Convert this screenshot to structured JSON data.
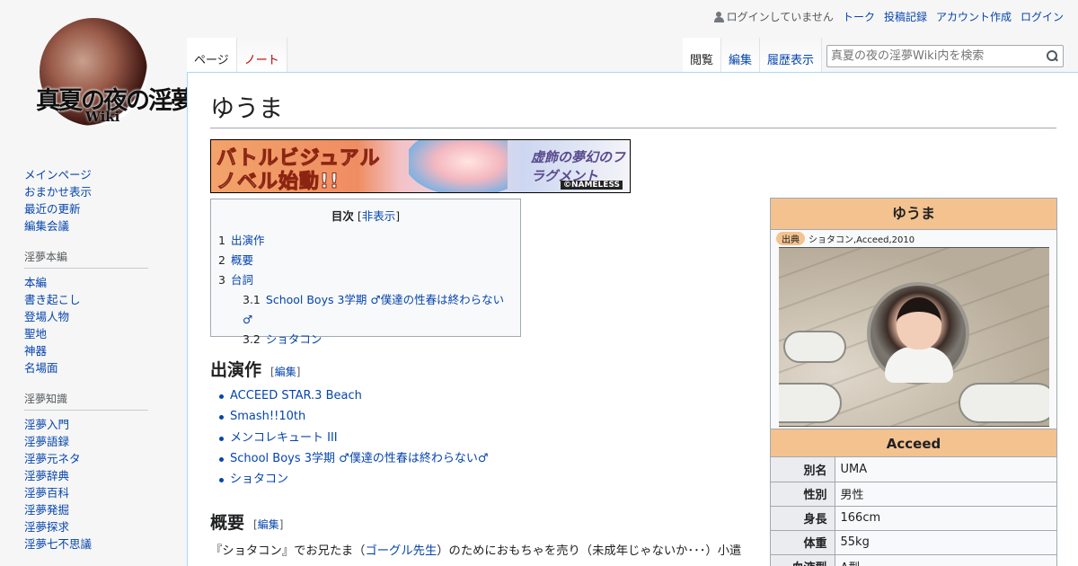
{
  "personal": {
    "status": "ログインしていません",
    "talk": "トーク",
    "contributions": "投稿記録",
    "create_account": "アカウント作成",
    "login": "ログイン"
  },
  "logo": {
    "title": "真夏の夜の淫夢",
    "subtitle": "Wiki"
  },
  "sidebar": {
    "main": [
      "メインページ",
      "おまかせ表示",
      "最近の更新",
      "編集会議"
    ],
    "section1": {
      "heading": "淫夢本編",
      "items": [
        "本編",
        "書き起こし",
        "登場人物",
        "聖地",
        "神器",
        "名場面"
      ]
    },
    "section2": {
      "heading": "淫夢知識",
      "items": [
        "淫夢入門",
        "淫夢語録",
        "淫夢元ネタ",
        "淫夢辞典",
        "淫夢百科",
        "淫夢発掘",
        "淫夢探求",
        "淫夢七不思議"
      ]
    }
  },
  "tabs": {
    "page": "ページ",
    "note": "ノート",
    "read": "閲覧",
    "edit": "編集",
    "history": "履歴表示"
  },
  "search": {
    "placeholder": "真夏の夜の淫夢Wiki内を検索"
  },
  "page": {
    "title": "ゆうま"
  },
  "banner": {
    "line1": "バトルビジュアル",
    "line2": "ノベル始動!!",
    "brand": "虚飾の夢幻のフラグメント",
    "copyright": "©NAMELESS"
  },
  "toc": {
    "title": "目次",
    "toggle_open": "[",
    "toggle": "非表示",
    "toggle_close": "]",
    "items": [
      {
        "num": "1",
        "label": "出演作"
      },
      {
        "num": "2",
        "label": "概要"
      },
      {
        "num": "3",
        "label": "台詞"
      },
      {
        "num": "3.1",
        "label": "School Boys 3学期 ♂僕達の性春は終わらない♂"
      },
      {
        "num": "3.2",
        "label": "ショタコン"
      }
    ]
  },
  "sections": {
    "works_heading": "出演作",
    "overview_heading": "概要",
    "edit_label": "編集",
    "edit_open": "[",
    "edit_close": "]"
  },
  "works": [
    "ACCEED STAR.3 Beach",
    "Smash!!10th",
    "メンコレキュート III",
    "School Boys 3学期 ♂僕達の性春は終わらない♂",
    "ショタコン"
  ],
  "overview": {
    "before": "『ショタコン』でお兄たま（",
    "link": "ゴーグル先生",
    "after": "）のためにおもちゃを売り（未成年じゃないか･･･）小遣"
  },
  "infobox": {
    "title": "ゆうま",
    "source_tag": "出典",
    "source": "ショタコン,Acceed,2010",
    "section": "Acceed",
    "rows": [
      {
        "key": "別名",
        "value": "UMA"
      },
      {
        "key": "性別",
        "value": "男性"
      },
      {
        "key": "身長",
        "value": "166cm"
      },
      {
        "key": "体重",
        "value": "55kg"
      },
      {
        "key": "血液型",
        "value": "A型"
      }
    ]
  },
  "colors": {
    "link": "#0645ad",
    "new_link": "#ba0000",
    "infobox_header": "#f3c28f"
  }
}
